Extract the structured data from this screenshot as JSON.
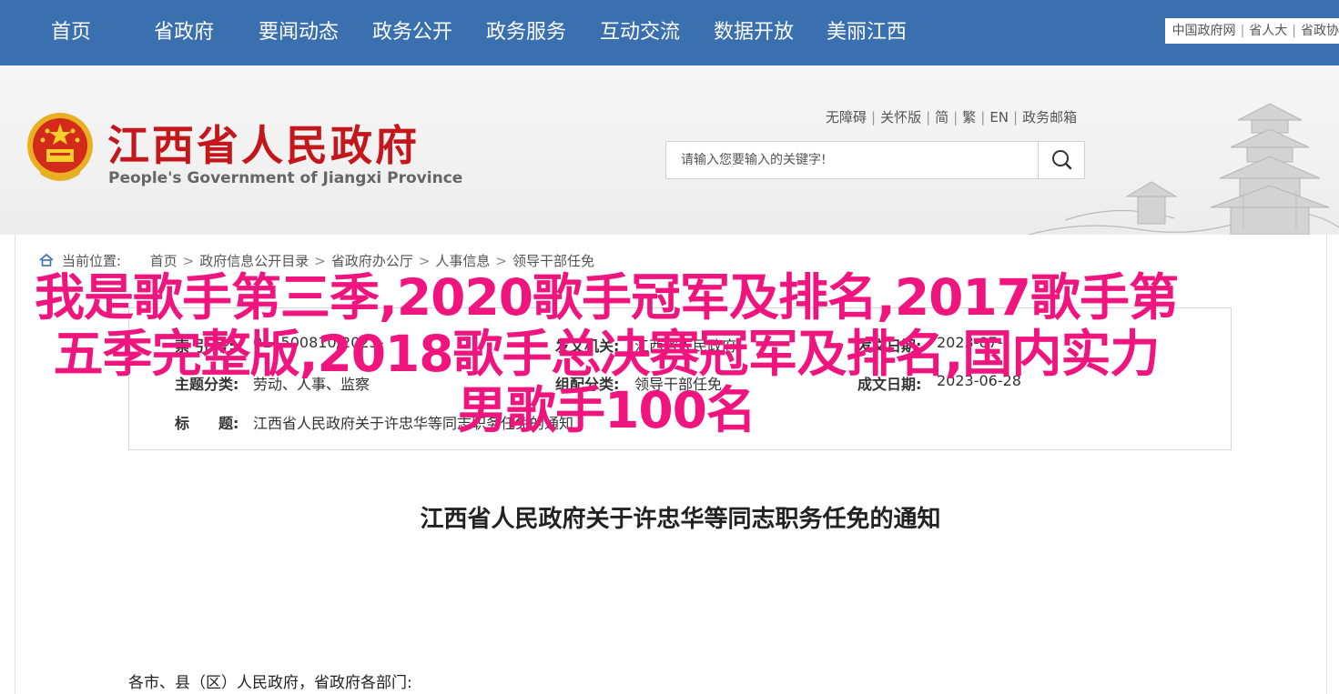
{
  "nav": {
    "items": [
      "首页",
      "省政府",
      "要闻动态",
      "政务公开",
      "政务服务",
      "互动交流",
      "数据开放",
      "美丽江西"
    ],
    "top_links": [
      "中国政府网",
      "省人大",
      "省政协"
    ]
  },
  "header": {
    "title": "江西省人民政府",
    "subtitle": "People's Government of Jiangxi Province",
    "util_links": [
      "无障碍",
      "关怀版",
      "简",
      "繁",
      "EN",
      "政务邮箱"
    ],
    "search_placeholder": "请输入您要输入的关键字!"
  },
  "breadcrumb": {
    "label": "当前位置:",
    "items": [
      "首页",
      "政府信息公开目录",
      "省政府办公厅",
      "人事信息",
      "领导干部任免"
    ]
  },
  "meta": {
    "index_label": "索  引  号:",
    "index_value": "014500810/2023-",
    "issuer_label": "发文机关:",
    "issuer_value": "江西省人民政府",
    "date_label": "发文日期:",
    "date_value": "2023-07-",
    "topic_label": "主题分类:",
    "topic_value": "劳动、人事、监察",
    "category_label": "组配分类:",
    "category_value": "领导干部任免",
    "effective_label": "成文日期:",
    "effective_value": "2023-06-28",
    "title_label": "标　　题:",
    "title_value": "江西省人民政府关于许忠华等同志职务任免的通知"
  },
  "doc": {
    "title": "江西省人民政府关于许忠华等同志职务任免的通知",
    "salutation": "各市、县（区）人民政府，省政府各部门:"
  },
  "overlay": {
    "text": "我是歌手第三季,2020歌手冠军及排名,2017歌手第五季完整版,2018歌手总决赛冠军及排名,国内实力男歌手100名"
  },
  "colors": {
    "nav_bg": "#3a6fb0",
    "title_red": "#c4171c",
    "overlay_pink": "#f0147f"
  }
}
